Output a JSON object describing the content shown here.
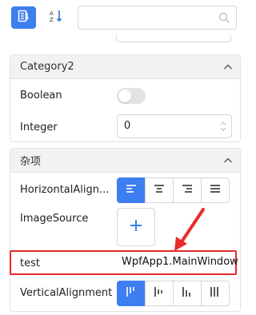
{
  "toolbar": {
    "categorized_icon": "categorized-sort-icon",
    "alpha_icon": "alphabetical-sort-icon",
    "alpha_glyph": "A↓Z",
    "search_placeholder": "",
    "search_icon": "search-icon"
  },
  "categories": [
    {
      "name": "Category2",
      "properties": [
        {
          "label": "Boolean",
          "editor": "toggle",
          "value": false
        },
        {
          "label": "Integer",
          "editor": "numeric",
          "value": "0"
        }
      ]
    },
    {
      "name": "杂项",
      "properties": [
        {
          "label": "HorizontalAlign...",
          "editor": "segmented",
          "options": [
            "left",
            "center",
            "right",
            "stretch"
          ],
          "selected": "left"
        },
        {
          "label": "ImageSource",
          "editor": "image-picker",
          "value": ""
        },
        {
          "label": "test",
          "editor": "text",
          "value": "WpfApp1.MainWindow"
        },
        {
          "label": "VerticalAlignment",
          "editor": "segmented",
          "options": [
            "top",
            "center",
            "bottom",
            "stretch"
          ],
          "selected": "top"
        }
      ]
    }
  ],
  "colors": {
    "accent": "#3d7ef0",
    "highlight": "#e82a2a",
    "header_bg": "#f2f2f2"
  }
}
